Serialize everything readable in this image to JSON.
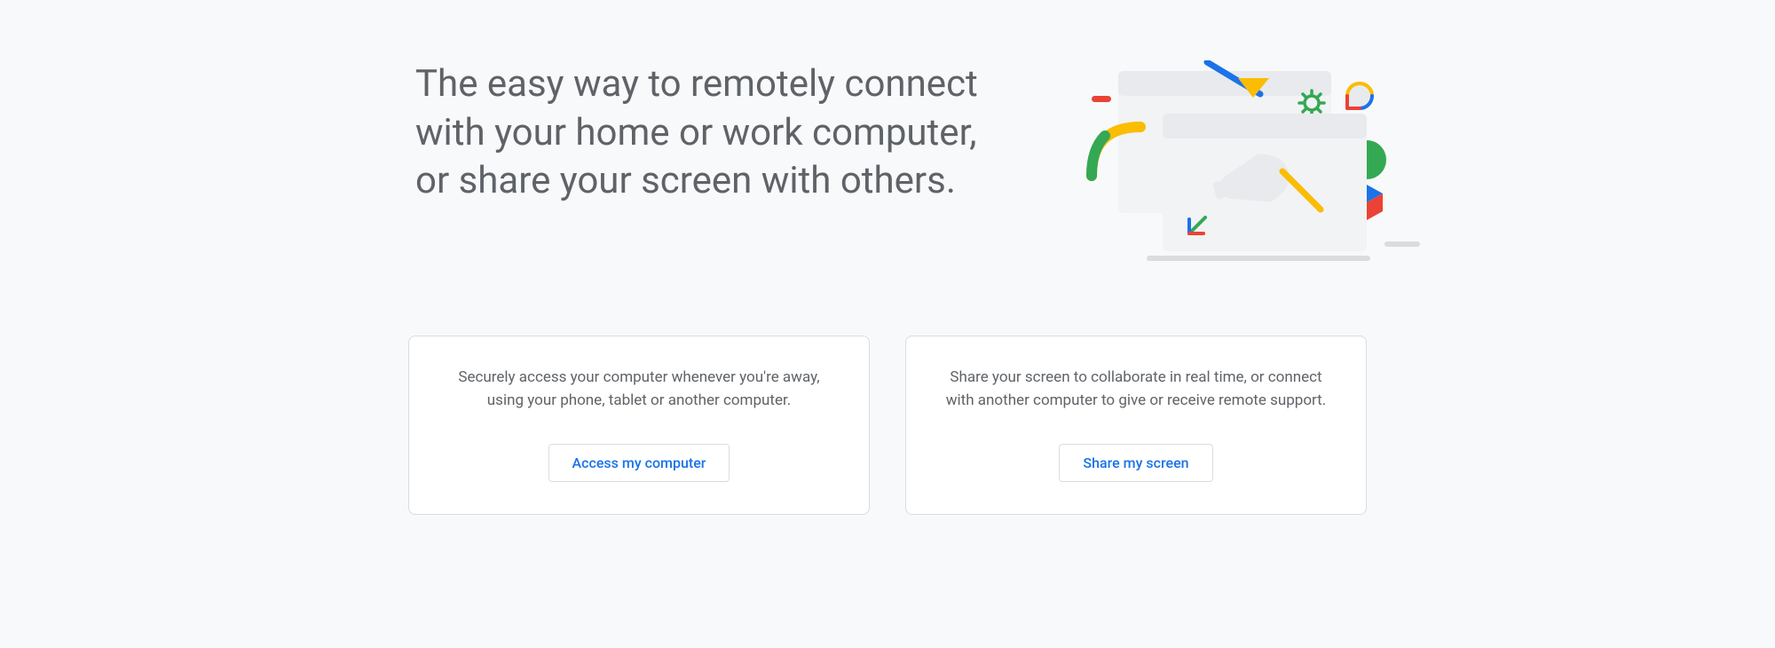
{
  "hero": {
    "headline": "The easy way to remotely connect with your home or work computer, or share your screen with others."
  },
  "cards": [
    {
      "description": "Securely access your computer whenever you're away, using your phone, tablet or another computer.",
      "button_label": "Access my computer"
    },
    {
      "description": "Share your screen to collaborate in real time, or connect with another computer to give or receive remote support.",
      "button_label": "Share my screen"
    }
  ]
}
